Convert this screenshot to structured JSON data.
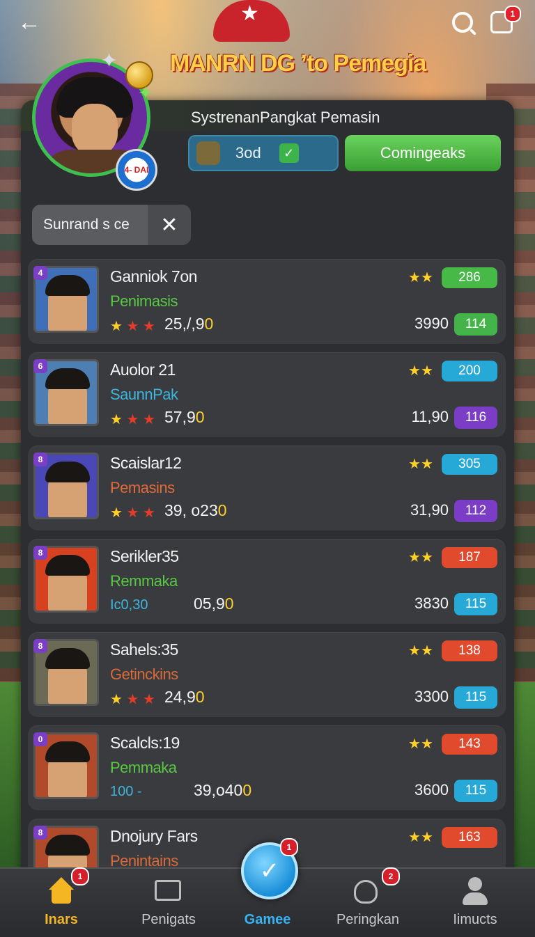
{
  "header": {
    "title": "MANRN DG ’to Pemegia",
    "notification_count": "1"
  },
  "profile": {
    "avatar_badge": "4- DAI",
    "section_title": "SystrenanPangkat Pemasin",
    "stat_value": "3od",
    "action_button": "Comingeaks"
  },
  "filter": {
    "text": "Sunrand s ce"
  },
  "rows": [
    {
      "rank": "4",
      "name": "Ganniok 7on",
      "sub": "Penimasis",
      "sub_color": "#58c843",
      "score_prefix": "25,/,9",
      "score_tail": "0",
      "bar_value": "286",
      "bar_color": "#46b947",
      "right_value": "3990",
      "pill_value": "114",
      "pill_color": "#44b44a",
      "thumb_bg": "#3e6fb8"
    },
    {
      "rank": "6",
      "name": "Auolor 21",
      "sub": "SaunnPak",
      "sub_color": "#3cb6de",
      "score_prefix": "57,9",
      "score_tail": "0",
      "bar_value": "200",
      "bar_color": "#27a9d8",
      "right_value": "11,90",
      "pill_value": "116",
      "pill_color": "#7b3dc6",
      "thumb_bg": "#4d7fb5"
    },
    {
      "rank": "8",
      "name": "Scaislar12",
      "sub": "Pemasins",
      "sub_color": "#e06a3a",
      "score_prefix": "39, o23",
      "score_tail": "0",
      "bar_value": "305",
      "bar_color": "#27a9d8",
      "right_value": "31,90",
      "pill_value": "112",
      "pill_color": "#7b3dc6",
      "thumb_bg": "#4a47b6"
    },
    {
      "rank": "8",
      "name": "Serikler35",
      "sub": "Remmaka",
      "sub_color": "#58c843",
      "score_prefix": "05,9",
      "score_tail": "0",
      "bar_value": "187",
      "bar_color": "#e24a2e",
      "right_value": "3830",
      "pill_value": "115",
      "pill_color": "#27a9d8",
      "thumb_bg": "#d8411f",
      "prefix_text": "Ic0,30"
    },
    {
      "rank": "8",
      "name": "Sahels:35",
      "sub": "Getinckins",
      "sub_color": "#d86a3a",
      "score_prefix": "24,9",
      "score_tail": "0",
      "bar_value": "138",
      "bar_color": "#e24a2e",
      "right_value": "3300",
      "pill_value": "115",
      "pill_color": "#27a9d8",
      "thumb_bg": "#6a6a55"
    },
    {
      "rank": "0",
      "name": "Scalcls:19",
      "sub": "Pemmaka",
      "sub_color": "#58c843",
      "score_prefix": "39,o40",
      "score_tail": "0",
      "bar_value": "143",
      "bar_color": "#e24a2e",
      "right_value": "3600",
      "pill_value": "115",
      "pill_color": "#27a9d8",
      "thumb_bg": "#b14a2a",
      "prefix_text": "100 -"
    },
    {
      "rank": "8",
      "name": "Dnojury Fars",
      "sub": "Penintains",
      "sub_color": "#d86a3a",
      "score_prefix": "",
      "score_tail": "",
      "bar_value": "163",
      "bar_color": "#e24a2e",
      "right_value": "",
      "pill_value": "",
      "pill_color": "#27a9d8",
      "thumb_bg": "#b14a2a"
    }
  ],
  "nav": {
    "items": [
      {
        "label": "Inars",
        "badge": "1",
        "active_color": "#f4b623"
      },
      {
        "label": "Penigats",
        "badge": ""
      },
      {
        "label": "Gamee",
        "badge": "1",
        "active_color": "#37b4f2"
      },
      {
        "label": "Peringkan",
        "badge": "2"
      },
      {
        "label": "Iimucts",
        "badge": ""
      }
    ]
  }
}
